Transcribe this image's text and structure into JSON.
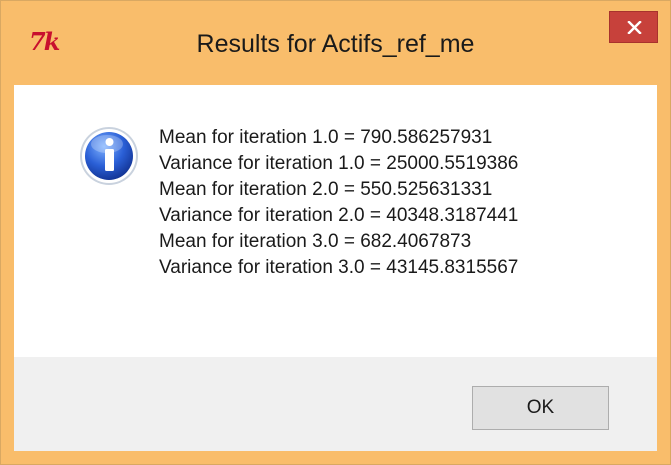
{
  "window": {
    "title": "Results for Actifs_ref_me",
    "app_icon_text": "7k",
    "close_glyph": "×",
    "accent_color": "#f9bd6b",
    "close_color": "#c7413b"
  },
  "dialog": {
    "icon": "info-icon",
    "lines": [
      "Mean for iteration 1.0 = 790.586257931",
      "Variance for iteration 1.0 = 25000.5519386",
      "Mean for iteration 2.0 = 550.525631331",
      "Variance for iteration 2.0 = 40348.3187441",
      "Mean for iteration 3.0 = 682.4067873",
      "Variance for iteration 3.0 = 43145.8315567"
    ]
  },
  "buttons": {
    "ok_label": "OK"
  }
}
